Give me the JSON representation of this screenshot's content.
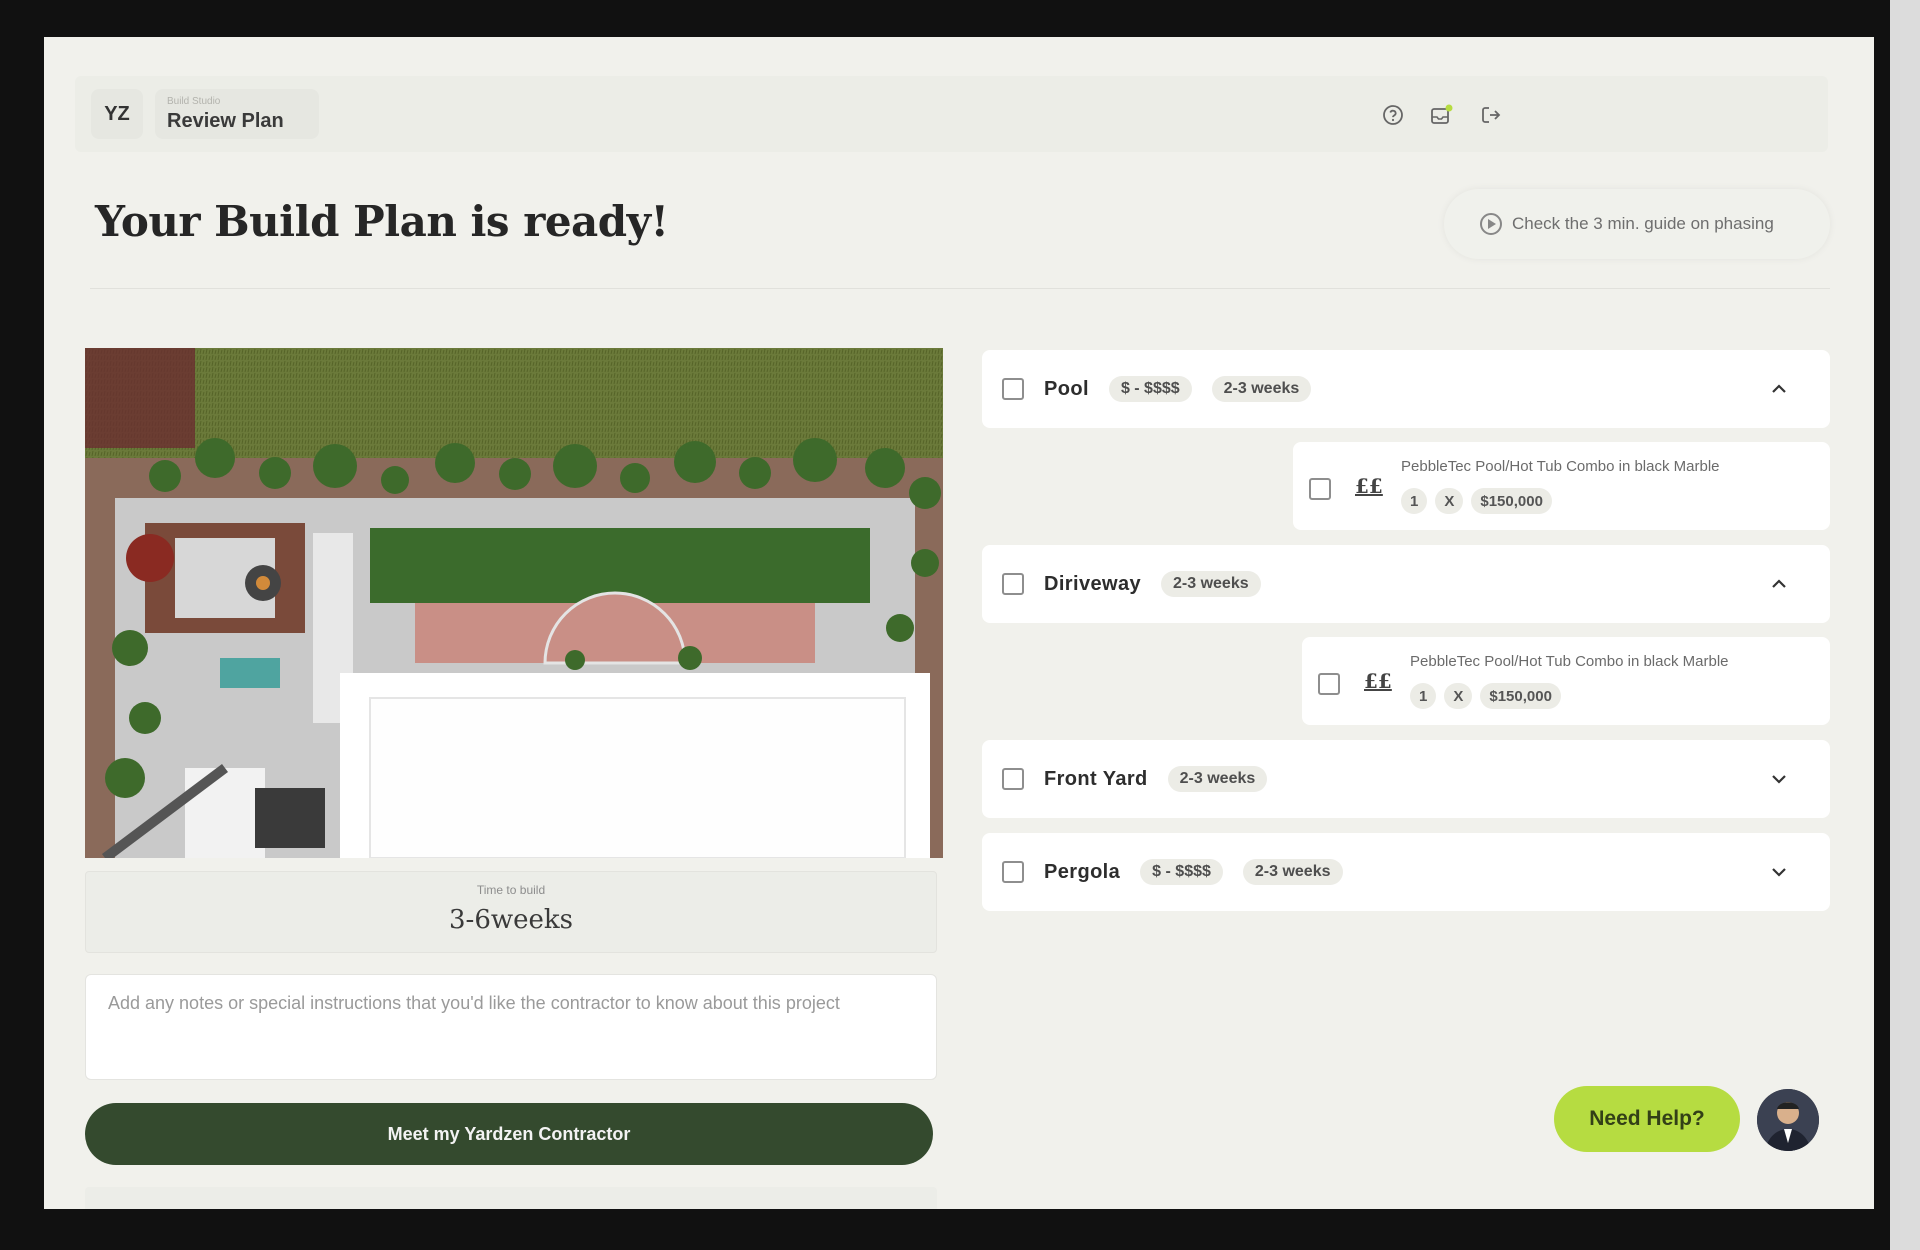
{
  "header": {
    "initials": "YZ",
    "breadcrumb_small": "Build Studio",
    "breadcrumb_main": "Review Plan",
    "icons": [
      "help-circle-icon",
      "notification-icon",
      "logout-icon"
    ]
  },
  "page": {
    "title": "Your Build Plan is ready!",
    "guide_label": "Check the 3 min. guide on phasing"
  },
  "plan": {
    "time_label": "Time to build",
    "time_value": "3-6weeks",
    "notes_placeholder": "Add any notes or special instructions that you'd like the contractor to know about this project",
    "cta_label": "Meet my Yardzen Contractor"
  },
  "phases": [
    {
      "name": "Pool",
      "price": "$ - $$$$",
      "duration": "2-3 weeks",
      "expanded": true,
      "item": {
        "currency": "££",
        "desc": "PebbleTec Pool/Hot Tub Combo in black Marble",
        "qty": "1",
        "x": "X",
        "price": "$150,000"
      }
    },
    {
      "name": "Diriveway",
      "price": "",
      "duration": "2-3 weeks",
      "expanded": true,
      "item": {
        "currency": "££",
        "desc": "PebbleTec Pool/Hot Tub Combo in black Marble",
        "qty": "1",
        "x": "X",
        "price": "$150,000"
      }
    },
    {
      "name": "Front Yard",
      "price": "",
      "duration": "2-3 weeks",
      "expanded": false
    },
    {
      "name": "Pergola",
      "price": "$ - $$$$",
      "duration": "2-3 weeks",
      "expanded": false
    }
  ],
  "support": {
    "help_label": "Need Help?"
  },
  "colors": {
    "cta": "#344a2e",
    "help": "#b6dc41",
    "background": "#f1f1ec"
  }
}
